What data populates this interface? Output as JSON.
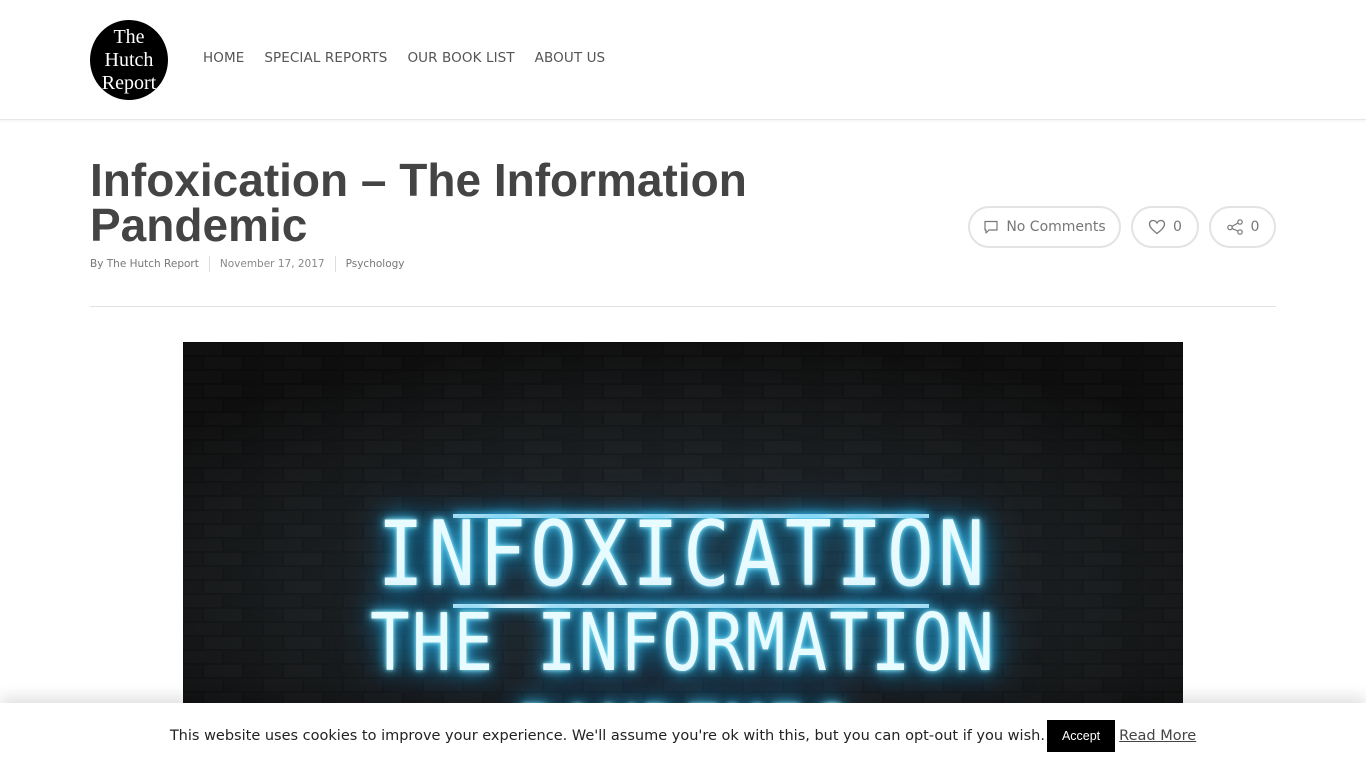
{
  "site": {
    "logo_lines": [
      "The",
      "Hutch",
      "Report"
    ]
  },
  "nav": {
    "items": [
      {
        "label": "HOME"
      },
      {
        "label": "SPECIAL REPORTS"
      },
      {
        "label": "OUR BOOK LIST"
      },
      {
        "label": "ABOUT US"
      }
    ]
  },
  "post": {
    "title": "Infoxication – The Information Pandemic",
    "author": "By The Hutch Report",
    "date": "November 17, 2017",
    "category": "Psychology",
    "comments_label": "No Comments",
    "likes_count": "0",
    "share_count": "0"
  },
  "featured_image": {
    "line1": "INFOXICATION",
    "line2": "THE INFORMATION PANDEMIC",
    "glow_color": "#4fd4ff"
  },
  "cookie": {
    "message": "This website uses cookies to improve your experience. We'll assume you're ok with this, but you can opt-out if you wish.",
    "accept_label": "Accept",
    "read_more_label": "Read More"
  }
}
